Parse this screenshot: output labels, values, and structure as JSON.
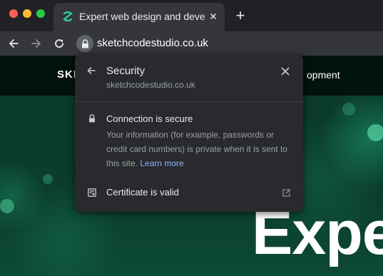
{
  "window": {
    "traffic_lights": [
      "close",
      "minimize",
      "zoom"
    ]
  },
  "tabs": [
    {
      "title": "Expert web design and development",
      "active": true,
      "icon": "site-favicon"
    }
  ],
  "toolbar": {
    "url": "sketchcodestudio.co.uk",
    "icons": [
      "back-arrow-icon",
      "forward-arrow-icon",
      "reload-icon",
      "lock-icon"
    ]
  },
  "page": {
    "logo_text": "SKE",
    "nav_text": "opment",
    "hero_title": "Expe"
  },
  "security_popup": {
    "title": "Security",
    "domain": "sketchcodestudio.co.uk",
    "connection_heading": "Connection is secure",
    "connection_description": "Your information (for example, passwords or credit card numbers) is private when it is sent to this site.",
    "learn_more": "Learn more",
    "certificate_label": "Certificate is valid"
  },
  "colors": {
    "tab_bar": "#202124",
    "toolbar": "#35363a",
    "popup_bg": "#292a2d",
    "link": "#8ab4f8",
    "secondary_text": "#9aa0a6",
    "page_green": "#0b3c2d"
  }
}
